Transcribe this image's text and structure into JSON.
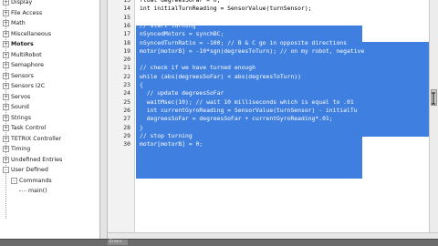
{
  "function_tree": {
    "items": [
      {
        "label": "Display",
        "expander": "+",
        "bold": false,
        "indent": 0
      },
      {
        "label": "File Access",
        "expander": "+",
        "bold": false,
        "indent": 0
      },
      {
        "label": "Math",
        "expander": "+",
        "bold": false,
        "indent": 0
      },
      {
        "label": "Miscellaneous",
        "expander": "+",
        "bold": false,
        "indent": 0
      },
      {
        "label": "Motors",
        "expander": "+",
        "bold": true,
        "indent": 0
      },
      {
        "label": "MultiRobot",
        "expander": "+",
        "bold": false,
        "indent": 0
      },
      {
        "label": "Semaphore",
        "expander": "+",
        "bold": false,
        "indent": 0
      },
      {
        "label": "Sensors",
        "expander": "+",
        "bold": false,
        "indent": 0
      },
      {
        "label": "Sensors I2C",
        "expander": "+",
        "bold": false,
        "indent": 0
      },
      {
        "label": "Servos",
        "expander": "+",
        "bold": false,
        "indent": 0
      },
      {
        "label": "Sound",
        "expander": "+",
        "bold": false,
        "indent": 0
      },
      {
        "label": "Strings",
        "expander": "+",
        "bold": false,
        "indent": 0
      },
      {
        "label": "Task Control",
        "expander": "+",
        "bold": false,
        "indent": 0
      },
      {
        "label": "TETRIX Controller",
        "expander": "+",
        "bold": false,
        "indent": 0
      },
      {
        "label": "Timing",
        "expander": "+",
        "bold": false,
        "indent": 0
      },
      {
        "label": "Undefined Entries",
        "expander": "+",
        "bold": false,
        "indent": 0
      },
      {
        "label": "User Defined",
        "expander": "-",
        "bold": false,
        "indent": 0
      },
      {
        "label": "Commands",
        "expander": "-",
        "bold": false,
        "indent": 1
      },
      {
        "label": "main()",
        "expander": "",
        "bold": false,
        "indent": 2
      }
    ]
  },
  "editor": {
    "line_numbers": [
      "13",
      "14",
      "15",
      "16",
      "17",
      "18",
      "19",
      "20",
      "21",
      "22",
      "23",
      "24",
      "25",
      "26",
      "27",
      "28",
      "29",
      "30"
    ],
    "lines": [
      {
        "text": "float degreesSoFar = 0;",
        "selected": false
      },
      {
        "text": "int initialTurnReading = SensorValue(turnSensor);",
        "selected": false
      },
      {
        "text": "",
        "selected": false
      },
      {
        "text": "// start turning",
        "selected": true
      },
      {
        "text": "nSyncedMotors = synchBC;",
        "selected": true
      },
      {
        "text": "nSyncedTurnRatio = -100; // B & C go in opposite directions",
        "selected": true
      },
      {
        "text": "motor[motorB] = -10*sgn(degreesToTurn); // on my robot, negative",
        "selected": true
      },
      {
        "text": "",
        "selected": true
      },
      {
        "text": "// check if we have turned enough",
        "selected": true
      },
      {
        "text": "while (abs(degreesSoFar) < abs(degreesToTurn))",
        "selected": true
      },
      {
        "text": "{",
        "selected": true
      },
      {
        "text": "  // update degreesSoFar",
        "selected": true
      },
      {
        "text": "  waitMsec(10); // wait 10 milliseconds which is equal to .01",
        "selected": true
      },
      {
        "text": "  int currentGyroReading = SensorValue(turnSensor) - initialTu",
        "selected": true
      },
      {
        "text": "  degreesSoFar = degreesSoFar + currentGyroReading*.01;",
        "selected": true
      },
      {
        "text": "}",
        "selected": true
      },
      {
        "text": "// stop turning",
        "selected": true
      },
      {
        "text": "motor[motorB] = 0;",
        "selected": true
      }
    ]
  },
  "bottom_tab": {
    "label": "Errors"
  },
  "colors": {
    "selection": "#3f7fe0",
    "selection_text": "#ffffff"
  }
}
